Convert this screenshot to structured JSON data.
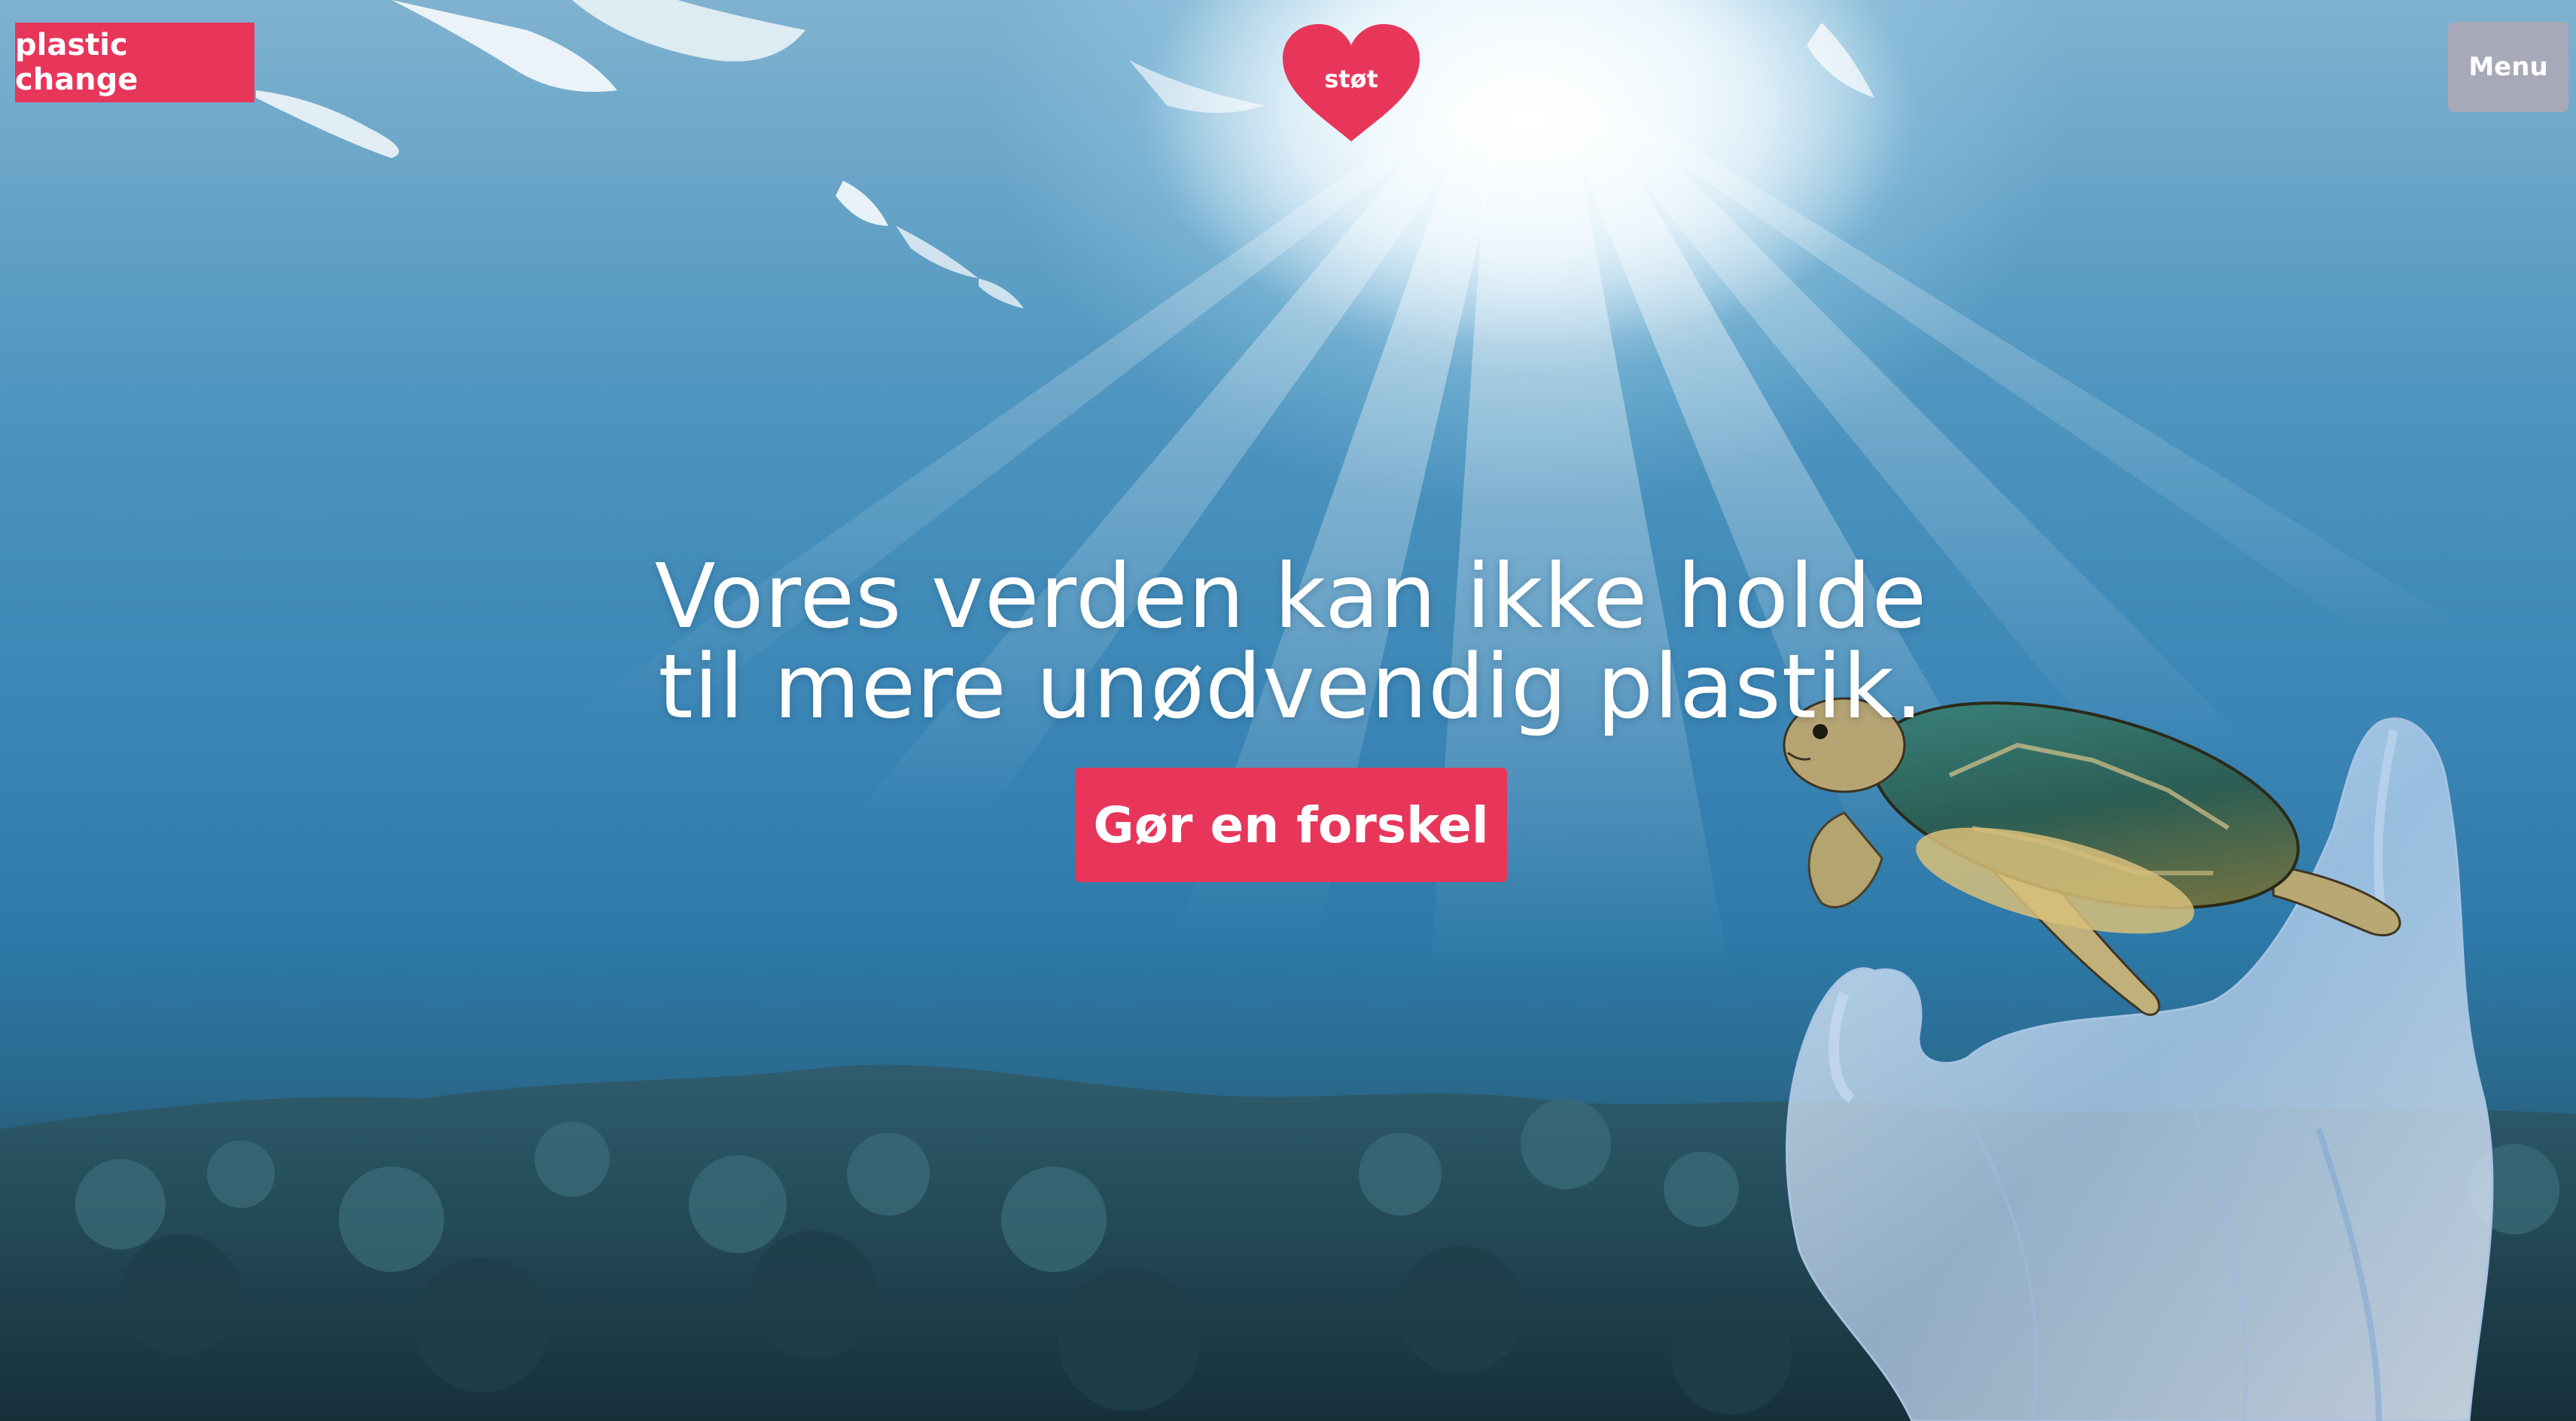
{
  "header": {
    "logo_text": "plastic change",
    "donate_label": "støt",
    "menu_label": "Menu"
  },
  "hero": {
    "headline_line1": "Vores verden kan ikke holde",
    "headline_line2": "til mere unødvendig plastik.",
    "cta_label": "Gør en forskel"
  },
  "colors": {
    "brand_red": "#e8365b",
    "menu_grey": "#a7a9b9",
    "text_white": "#ffffff"
  },
  "icons": {
    "donate": "heart-icon",
    "background": "underwater-scene-with-turtle-and-plastic-bag"
  }
}
